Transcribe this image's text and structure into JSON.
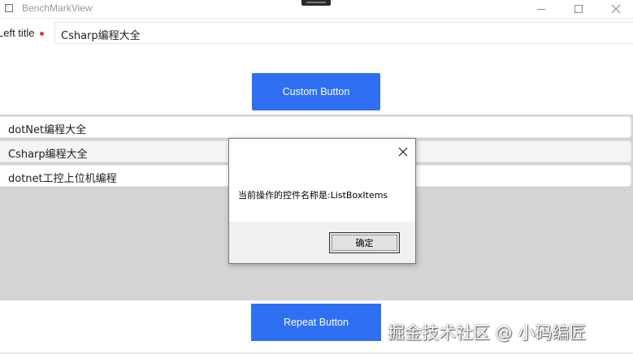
{
  "window": {
    "title": "BenchMarkView",
    "controls": {
      "minimize_icon": "minimize-icon",
      "maximize_icon": "maximize-icon",
      "close_icon": "close-icon"
    }
  },
  "form": {
    "left_title_label": "Left title",
    "title_input_value": "Csharp编程大全",
    "required_marker_color": "#d23b3b"
  },
  "buttons": {
    "custom_label": "Custom Button",
    "repeat_label": "Repeat Button",
    "accent_color": "#2f6ff2"
  },
  "listbox": {
    "items": [
      {
        "label": "dotNet编程大全"
      },
      {
        "label": "Csharp编程大全"
      },
      {
        "label": "dotnet工控上位机编程"
      }
    ]
  },
  "dialog": {
    "message": "当前操作的控件名称是:ListBoxItems",
    "ok_label": "确定"
  },
  "watermark": {
    "text": "掘金技术社区 @ 小码编匠"
  }
}
